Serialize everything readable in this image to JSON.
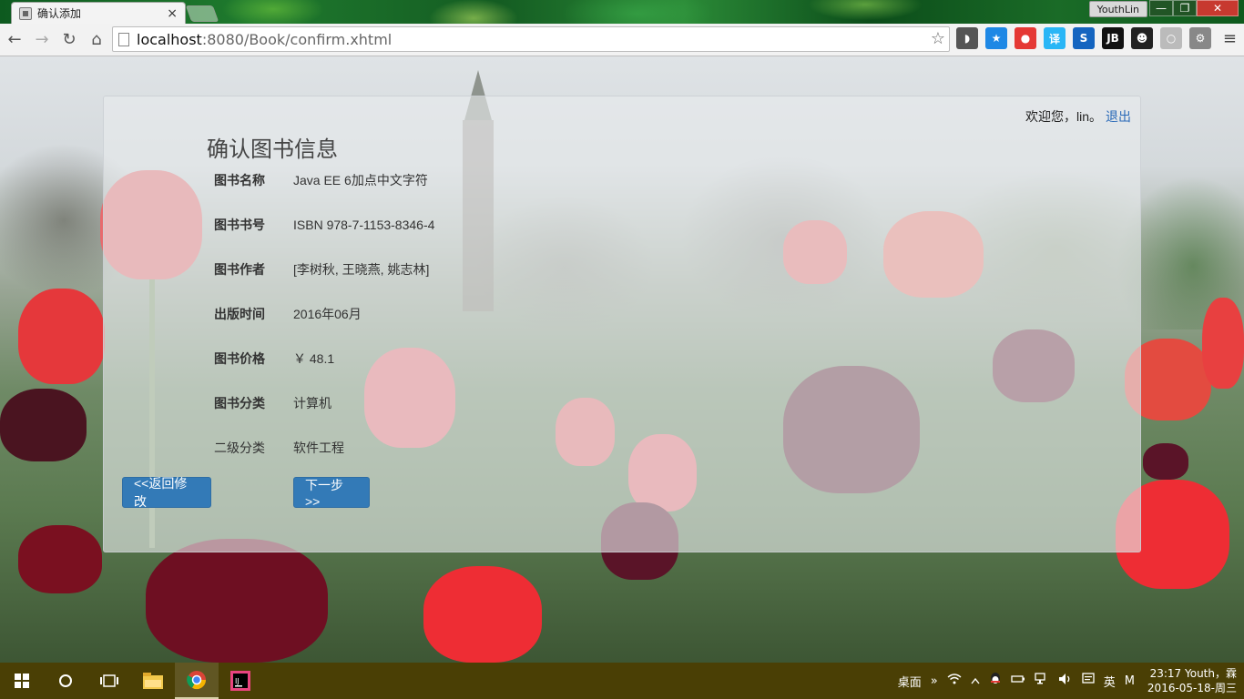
{
  "browser": {
    "tab_title": "确认添加",
    "tab_close": "×",
    "profile_name": "YouthLin",
    "url_host": "localhost",
    "url_rest": ":8080/Book/confirm.xhtml",
    "window_controls": {
      "minimize": "—",
      "restore": "❐",
      "close": "✕"
    },
    "nav": {
      "back": "←",
      "forward": "→",
      "reload": "↻",
      "home": "⌂"
    },
    "star": "☆",
    "menu": "≡",
    "extensions": [
      {
        "name": "pocket-icon",
        "label": "◗",
        "color": "#555555"
      },
      {
        "name": "bookmark-star-icon",
        "label": "★",
        "color": "#1e88e5"
      },
      {
        "name": "adblock-icon",
        "label": "●",
        "color": "#e53935"
      },
      {
        "name": "translate-icon",
        "label": "译",
        "color": "#29b6f6"
      },
      {
        "name": "s-extension-icon",
        "label": "S",
        "color": "#1565c0"
      },
      {
        "name": "jetbrains-icon",
        "label": "JB",
        "color": "#111111"
      },
      {
        "name": "face-icon",
        "label": "☻",
        "color": "#222222"
      },
      {
        "name": "grey-circle-icon",
        "label": "○",
        "color": "#bbbbbb"
      },
      {
        "name": "puzzle-icon",
        "label": "⚙",
        "color": "#888888"
      }
    ]
  },
  "header": {
    "welcome_text": "欢迎您，lin。",
    "logout_label": "退出"
  },
  "main": {
    "title": "确认图书信息",
    "rows": [
      {
        "label": "图书名称",
        "value": "Java EE 6加点中文字符",
        "bold": true
      },
      {
        "label": "图书书号",
        "value": "ISBN 978-7-1153-8346-4",
        "bold": true
      },
      {
        "label": "图书作者",
        "value": "[李树秋, 王晓燕, 姚志林]",
        "bold": true
      },
      {
        "label": "出版时间",
        "value": "2016年06月",
        "bold": true
      },
      {
        "label": "图书价格",
        "value": "￥ 48.1",
        "bold": true
      },
      {
        "label": "图书分类",
        "value": "计算机",
        "bold": true
      },
      {
        "label": "二级分类",
        "value": "软件工程",
        "bold": false
      }
    ],
    "back_button": "<<返回修改",
    "next_button": "下一步>>"
  },
  "taskbar": {
    "desktop_label": "桌面",
    "chevron": "»",
    "ime_label": "英",
    "ime_mode": "M",
    "clock_line1": "23:17 Youth，霖",
    "clock_line2": "2016-05-18-周三"
  },
  "colors": {
    "accent": "#337ab7",
    "link": "#2a6ab8",
    "taskbar": "#4a3f05"
  }
}
